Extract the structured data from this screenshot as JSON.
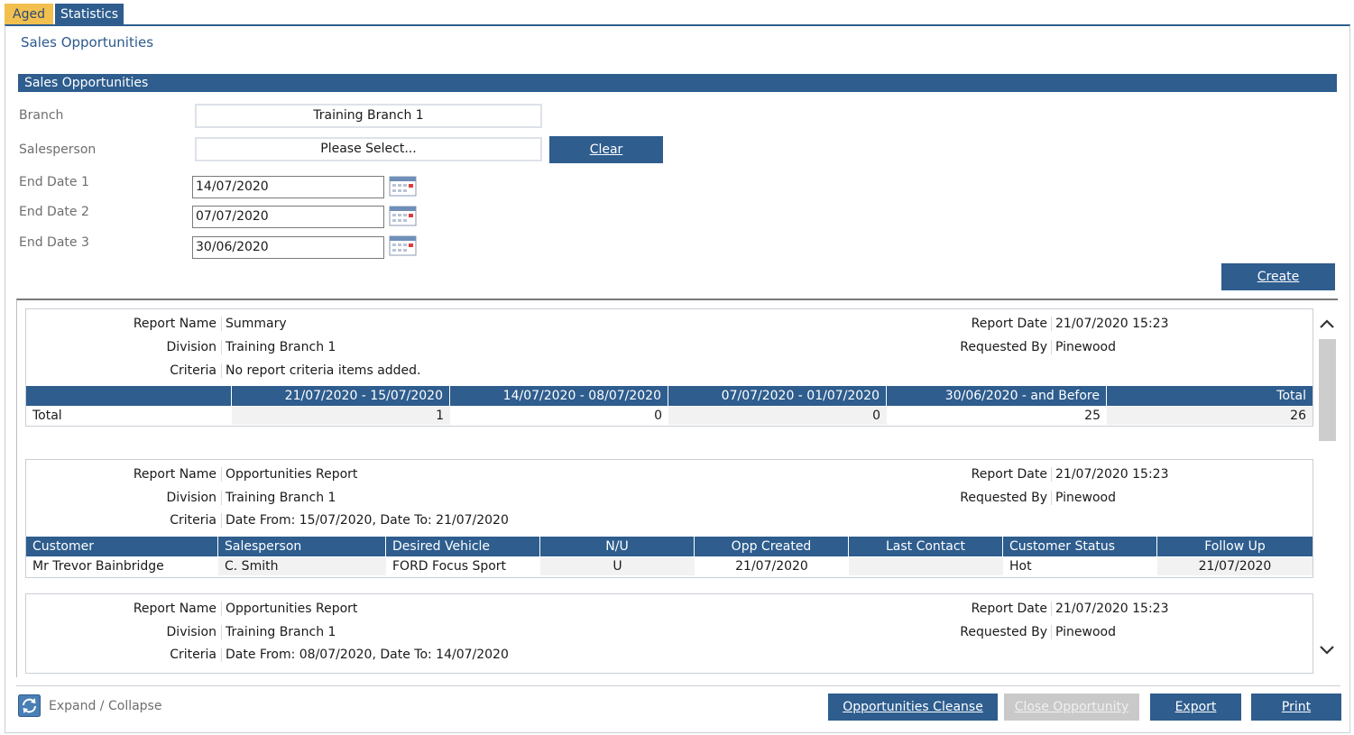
{
  "tabs": [
    {
      "label": "Aged",
      "active": true
    },
    {
      "label": "Statistics",
      "active": false
    }
  ],
  "page_title": "Sales Opportunities",
  "section_title": "Sales Opportunities",
  "form": {
    "branch_label": "Branch",
    "branch_value": "Training Branch 1",
    "salesperson_label": "Salesperson",
    "salesperson_value": "Please Select...",
    "clear_label": "Clear",
    "end_date_1_label": "End Date 1",
    "end_date_1_value": "14/07/2020",
    "end_date_2_label": "End Date 2",
    "end_date_2_value": "07/07/2020",
    "end_date_3_label": "End Date 3",
    "end_date_3_value": "30/06/2020",
    "create_label": "Create"
  },
  "reports": [
    {
      "meta": {
        "report_name_key": "Report Name",
        "report_name": "Summary",
        "division_key": "Division",
        "division": "Training Branch 1",
        "criteria_key": "Criteria",
        "criteria": "No report criteria items added.",
        "report_date_key": "Report Date",
        "report_date": "21/07/2020 15:23",
        "requested_by_key": "Requested By",
        "requested_by": "Pinewood"
      },
      "columns": [
        "",
        "21/07/2020 - 15/07/2020",
        "14/07/2020 - 08/07/2020",
        "07/07/2020 - 01/07/2020",
        "30/06/2020 - and Before",
        "Total"
      ],
      "row": [
        "Total",
        "1",
        "0",
        "0",
        "25",
        "26"
      ]
    },
    {
      "meta": {
        "report_name_key": "Report Name",
        "report_name": "Opportunities Report",
        "division_key": "Division",
        "division": "Training Branch 1",
        "criteria_key": "Criteria",
        "criteria": "Date From: 15/07/2020, Date To: 21/07/2020",
        "report_date_key": "Report Date",
        "report_date": "21/07/2020 15:23",
        "requested_by_key": "Requested By",
        "requested_by": "Pinewood"
      },
      "columns": [
        "Customer",
        "Salesperson",
        "Desired Vehicle",
        "N/U",
        "Opp Created",
        "Last Contact",
        "Customer Status",
        "Follow Up"
      ],
      "row": [
        "Mr Trevor Bainbridge",
        "C. Smith",
        "FORD Focus Sport",
        "U",
        "21/07/2020",
        "",
        "Hot",
        "21/07/2020"
      ]
    },
    {
      "meta": {
        "report_name_key": "Report Name",
        "report_name": "Opportunities Report",
        "division_key": "Division",
        "division": "Training Branch 1",
        "criteria_key": "Criteria",
        "criteria": "Date From: 08/07/2020, Date To: 14/07/2020",
        "report_date_key": "Report Date",
        "report_date": "21/07/2020 15:23",
        "requested_by_key": "Requested By",
        "requested_by": "Pinewood"
      }
    }
  ],
  "footer": {
    "expand_collapse_label": "Expand / Collapse",
    "opportunities_cleanse_label": "Opportunities Cleanse",
    "close_opportunity_label": "Close Opportunity",
    "export_label": "Export",
    "print_label": "Print"
  },
  "icons": {
    "calendar": "calendar-icon",
    "refresh": "refresh-icon",
    "scroll_up": "chevron-up-icon",
    "scroll_down": "chevron-down-icon"
  },
  "colors": {
    "primary": "#2e5d8e",
    "active_tab": "#f2c04e",
    "disabled": "#c9c9c9"
  }
}
